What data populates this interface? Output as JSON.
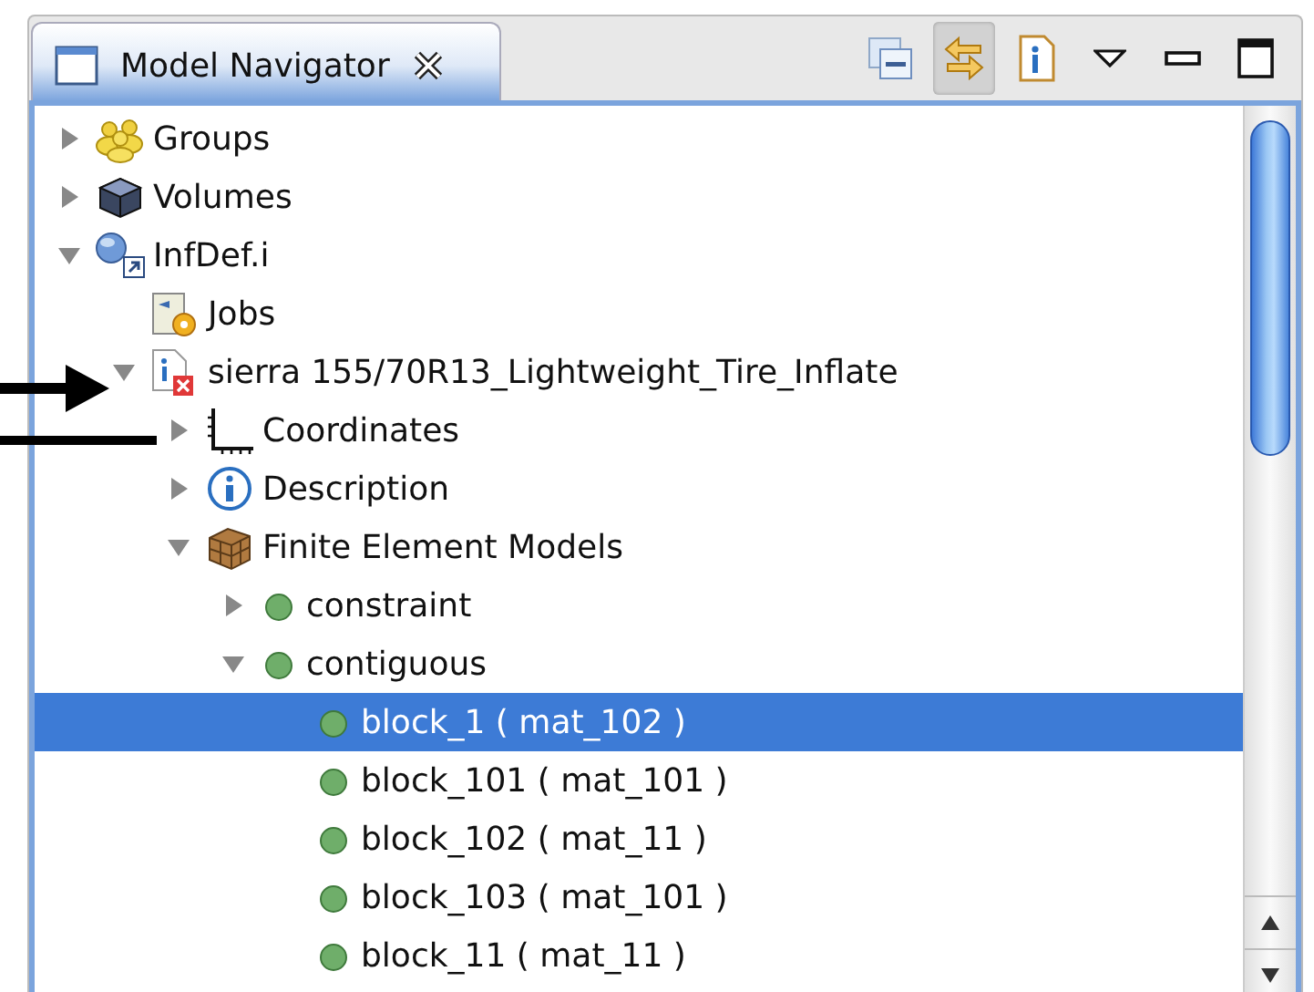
{
  "view": {
    "title": "Model Navigator",
    "toolbar": [
      {
        "kind": "collapse",
        "on": false
      },
      {
        "kind": "link",
        "on": true
      },
      {
        "kind": "info",
        "on": false
      },
      {
        "kind": "menu",
        "on": false
      },
      {
        "kind": "minimize",
        "on": false
      },
      {
        "kind": "maximize",
        "on": false
      }
    ]
  },
  "tree": [
    {
      "label": "Groups",
      "kind": "group",
      "expanded": false,
      "selected": false
    },
    {
      "label": "Volumes",
      "kind": "volume",
      "expanded": false,
      "selected": false
    },
    {
      "label": "InfDef.i",
      "kind": "model",
      "expanded": true,
      "selected": false,
      "children": [
        {
          "label": "Jobs",
          "kind": "jobs",
          "selected": false
        },
        {
          "label": "sierra 155/70R13_Lightweight_Tire_Inflate",
          "kind": "file",
          "expanded": true,
          "selected": false,
          "children": [
            {
              "label": "Coordinates",
              "kind": "axes",
              "expanded": false,
              "selected": false
            },
            {
              "label": "Description",
              "kind": "info",
              "expanded": false,
              "selected": false
            },
            {
              "label": "Finite Element Models",
              "kind": "mesh",
              "expanded": true,
              "selected": false,
              "children": [
                {
                  "label": "constraint",
                  "kind": "dot",
                  "expanded": false,
                  "selected": false
                },
                {
                  "label": "contiguous",
                  "kind": "dot",
                  "expanded": true,
                  "selected": false,
                  "children": [
                    {
                      "label": "block_1 ( mat_102 )",
                      "kind": "dot",
                      "selected": true
                    },
                    {
                      "label": "block_101 ( mat_101 )",
                      "kind": "dot",
                      "selected": false
                    },
                    {
                      "label": "block_102 ( mat_11 )",
                      "kind": "dot",
                      "selected": false
                    },
                    {
                      "label": "block_103 ( mat_101 )",
                      "kind": "dot",
                      "selected": false
                    },
                    {
                      "label": "block_11 ( mat_11 )",
                      "kind": "dot",
                      "selected": false
                    }
                  ]
                }
              ]
            }
          ]
        }
      ]
    }
  ]
}
